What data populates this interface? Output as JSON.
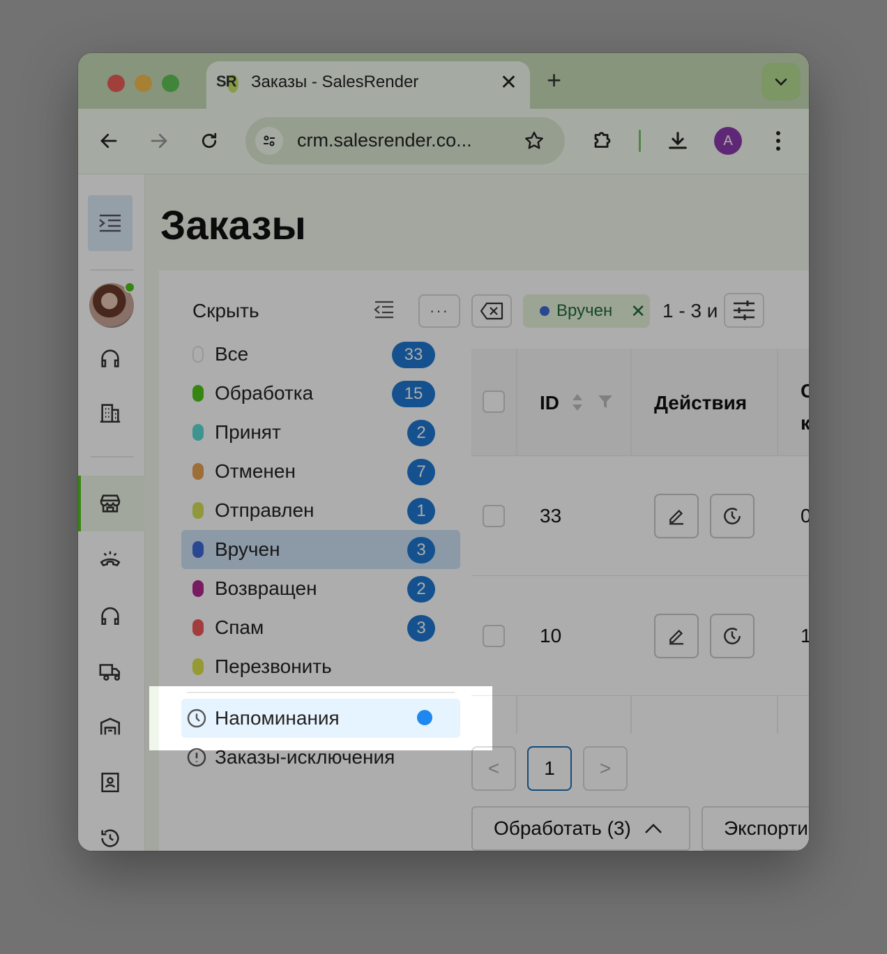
{
  "browser": {
    "tab_favicon_text": "SR",
    "tab_title": "Заказы - SalesRender",
    "tab_close": "✕",
    "new_tab": "+",
    "url": "crm.salesrender.co...",
    "profile_initial": "A"
  },
  "page": {
    "title": "Заказы"
  },
  "status_panel": {
    "hide_label": "Скрыть",
    "more_label": "···",
    "statuses": [
      {
        "label": "Все",
        "count": "33",
        "color": "#ffffff"
      },
      {
        "label": "Обработка",
        "count": "15",
        "color": "#52c41a"
      },
      {
        "label": "Принят",
        "count": "2",
        "color": "#5cdbd3"
      },
      {
        "label": "Отменен",
        "count": "7",
        "color": "#e8a350"
      },
      {
        "label": "Отправлен",
        "count": "1",
        "color": "#d4e157"
      },
      {
        "label": "Вручен",
        "count": "3",
        "color": "#3f69d8"
      },
      {
        "label": "Возвращен",
        "count": "2",
        "color": "#b3288f"
      },
      {
        "label": "Спам",
        "count": "3",
        "color": "#f05a5a"
      },
      {
        "label": "Перезвонить",
        "count": "",
        "color": "#dde34a"
      }
    ],
    "reminders_label": "Напоминания",
    "exceptions_label": "Заказы-исключения"
  },
  "filters": {
    "active_filter_chip": "Вручен",
    "active_filter_remove": "✕",
    "pager_info": "1 - 3 и"
  },
  "table": {
    "headers": {
      "id": "ID",
      "actions": "Действия",
      "next_col_line1": "С",
      "next_col_line2": "к"
    },
    "rows": [
      {
        "id": "33",
        "next_col": "0"
      },
      {
        "id": "10",
        "next_col": "1"
      }
    ]
  },
  "pagination": {
    "prev": "<",
    "current": "1",
    "next": ">"
  },
  "bottom_actions": {
    "process": "Обработать (3)",
    "export": "Экспорти"
  },
  "colors": {
    "accent": "#1e78d2",
    "selected_status_bg": "#cfe3f6",
    "active_nav": "#52c41a"
  }
}
